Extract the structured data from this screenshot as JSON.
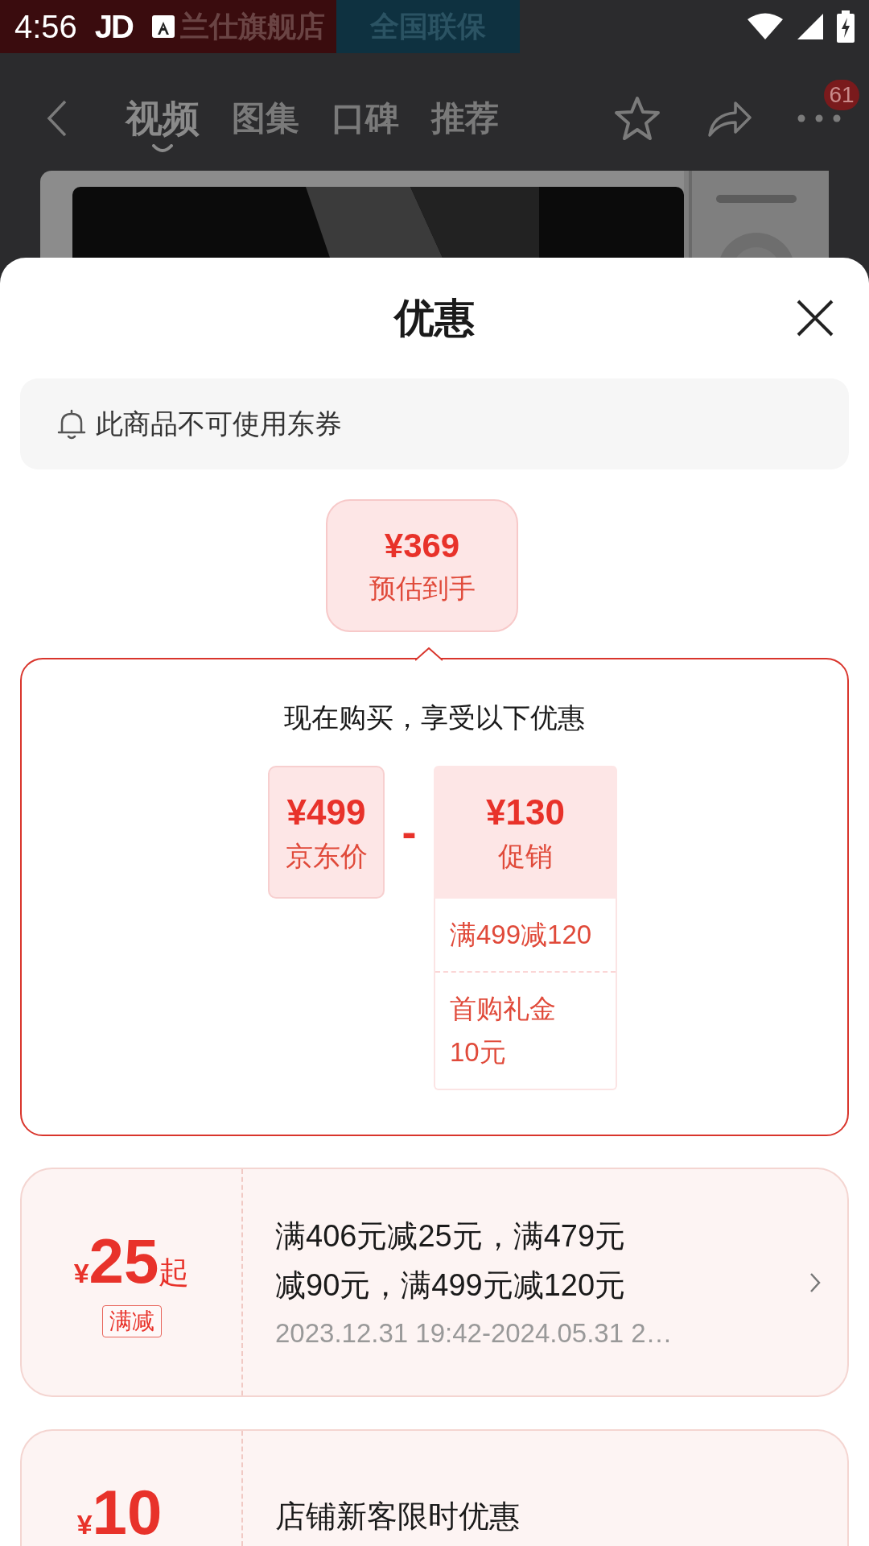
{
  "status_bar": {
    "time": "4:56",
    "app_label": "JD"
  },
  "background": {
    "store_banner": [
      "兰仕旗舰店",
      "全国联保"
    ],
    "tabs": [
      {
        "label": "视频",
        "selected": true
      },
      {
        "label": "图集",
        "selected": false
      },
      {
        "label": "口碑",
        "selected": false
      },
      {
        "label": "推荐",
        "selected": false
      }
    ],
    "more_badge": "61"
  },
  "sheet": {
    "title": "优惠",
    "notice": "此商品不可使用东券",
    "estimate": {
      "price": "¥369",
      "label": "预估到手"
    },
    "breakdown": {
      "heading": "现在购买，享受以下优惠",
      "base": {
        "price": "¥499",
        "label": "京东价"
      },
      "operator": "-",
      "promo": {
        "price": "¥130",
        "label": "促销",
        "items": [
          "满499减120",
          "首购礼金10元"
        ]
      }
    },
    "coupons": [
      {
        "currency": "¥",
        "amount": "25",
        "suffix": "起",
        "tag": "满减",
        "description": "满406元减25元，满479元减90元，满499元减120元",
        "date": "2023.12.31 19:42-2024.05.31 2…"
      },
      {
        "currency": "¥",
        "amount": "10",
        "description": "店铺新客限时优惠"
      }
    ]
  }
}
